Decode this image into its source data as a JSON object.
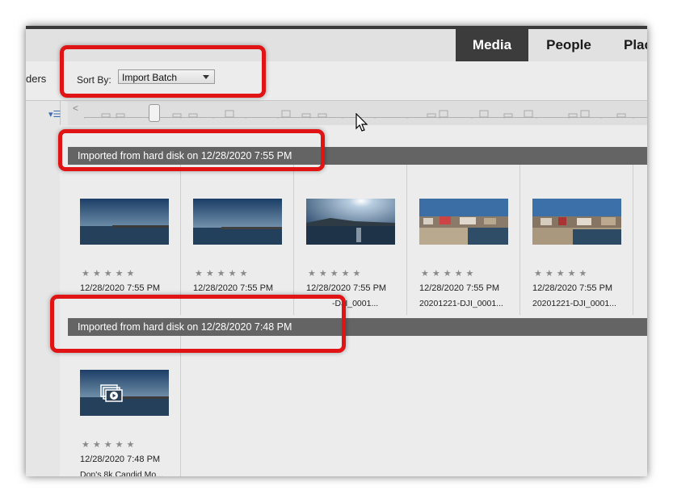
{
  "tabs": [
    {
      "label": "Media",
      "active": true
    },
    {
      "label": "People",
      "active": false
    },
    {
      "label": "Plac",
      "active": false
    }
  ],
  "toolbar": {
    "folders_label": "ders",
    "sort_label": "Sort By:",
    "sort_value": "Import Batch"
  },
  "timeline": {
    "left_arrow": "<"
  },
  "batches": [
    {
      "title": "Imported from hard disk on 12/28/2020 7:55 PM",
      "items": [
        {
          "stars": "★★★★★",
          "date": "12/28/2020 7:55 PM",
          "name": ""
        },
        {
          "stars": "★★★★★",
          "date": "12/28/2020 7:55 PM",
          "name": ""
        },
        {
          "stars": "★★★★★",
          "date": "12/28/2020 7:55 PM",
          "name": "-DJI_0001..."
        },
        {
          "stars": "★★★★★",
          "date": "12/28/2020 7:55 PM",
          "name": "20201221-DJI_0001..."
        },
        {
          "stars": "★★★★★",
          "date": "12/28/2020 7:55 PM",
          "name": "20201221-DJI_0001..."
        }
      ]
    },
    {
      "title": "Imported from hard disk on 12/28/2020 7:48 PM",
      "items": [
        {
          "stars": "★★★★★",
          "date": "12/28/2020 7:48 PM",
          "name": "Don's 8k Candid Mo..."
        }
      ]
    }
  ],
  "colors": {
    "highlight": "#e01414",
    "active_tab": "#3c3c3c",
    "batch_bar": "#646464"
  }
}
